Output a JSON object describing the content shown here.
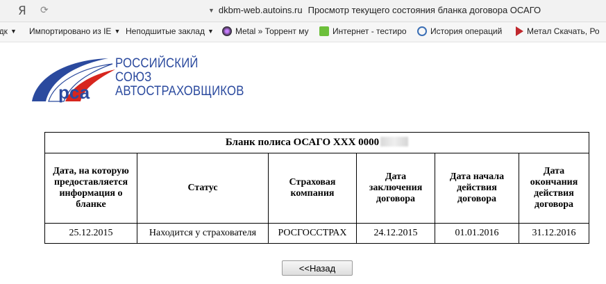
{
  "browser": {
    "logo": "Я",
    "url": "dkbm-web.autoins.ru",
    "page_title": "Просмотр текущего состояния бланка договора ОСАГО"
  },
  "bookmarks": [
    {
      "label": "адк",
      "arrow": "▼"
    },
    {
      "label": "Импортировано из IE",
      "arrow": "▼"
    },
    {
      "label": "Неподшитые заклад",
      "arrow": "▼"
    },
    {
      "label": "Metal » Торрент му",
      "icon": "metal-icon"
    },
    {
      "label": "Интернет - тестиро",
      "icon": "internet-test-icon"
    },
    {
      "label": "История операций",
      "icon": "history-icon"
    },
    {
      "label": "Метал Скачать, Ро",
      "icon": "play-icon"
    }
  ],
  "logo": {
    "abbr": "рса",
    "line1": "РОССИЙСКИЙ",
    "line2": "СОЮЗ",
    "line3": "АВТОСТРАХОВЩИКОВ"
  },
  "table": {
    "caption": "Бланк полиса ОСАГО ХХХ 0000",
    "headers": [
      "Дата, на которую предоставляется информация о бланке",
      "Статус",
      "Страховая компания",
      "Дата заключения договора",
      "Дата начала действия договора",
      "Дата окончания действия договора"
    ],
    "row": [
      "25.12.2015",
      "Находится у страхователя",
      "РОСГОССТРАХ",
      "24.12.2015",
      "01.01.2016",
      "31.12.2016"
    ]
  },
  "back_button": "<<Назад",
  "colors": {
    "logo_blue": "#2b4a9e",
    "logo_red": "#d7261e"
  }
}
